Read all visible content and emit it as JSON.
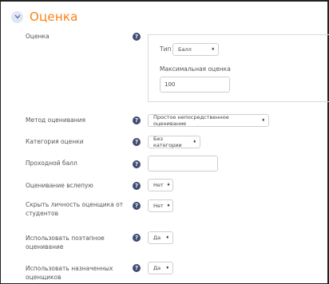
{
  "section": {
    "title": "Оценка"
  },
  "grade": {
    "label": "Оценка",
    "type_label": "Тип",
    "type_value": "Балл",
    "max_label": "Максимальная оценка",
    "max_value": "100"
  },
  "grading_method": {
    "label": "Метод оценивания",
    "value": "Простое непосредственное оценивание"
  },
  "grade_category": {
    "label": "Категория оценки",
    "value": "Без категории"
  },
  "pass_grade": {
    "label": "Проходной балл",
    "value": ""
  },
  "blind_marking": {
    "label": "Оценивание вслепую",
    "value": "Нет"
  },
  "hide_grader": {
    "label": "Скрыть личность оценщика от студентов",
    "value": "Нет"
  },
  "marking_workflow": {
    "label": "Использовать поэтапное оценивание",
    "value": "Да"
  },
  "marking_allocation": {
    "label": "Использовать назначенных оценщиков",
    "value": "Да"
  },
  "help_glyph": "?",
  "colors": {
    "accent": "#f98012",
    "help_icon": "#3f4b73"
  }
}
